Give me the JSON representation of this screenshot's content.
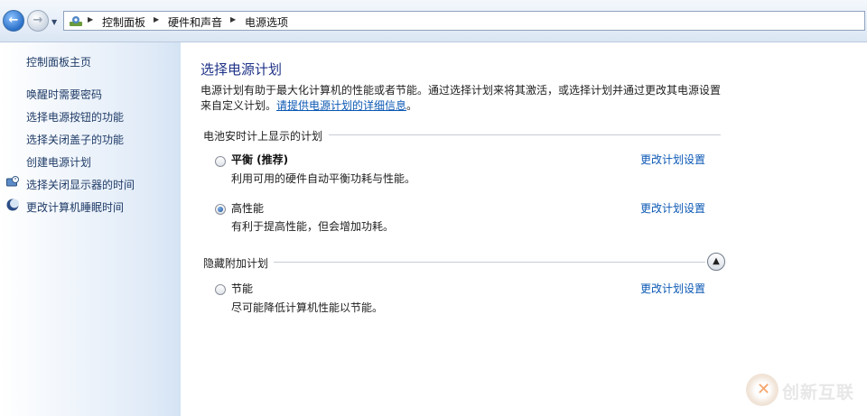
{
  "breadcrumb": [
    "控制面板",
    "硬件和声音",
    "电源选项"
  ],
  "sidebar": {
    "home": "控制面板主页",
    "links": [
      "唤醒时需要密码",
      "选择电源按钮的功能",
      "选择关闭盖子的功能",
      "创建电源计划"
    ],
    "icon_links": [
      "选择关闭显示器的时间",
      "更改计算机睡眠时间"
    ]
  },
  "main": {
    "title": "选择电源计划",
    "description": "电源计划有助于最大化计算机的性能或者节能。通过选择计划来将其激活，或选择计划并通过更改其电源设置来自定义计划。",
    "details_link": "请提供电源计划的详细信息",
    "details_end": "。",
    "battery_group": "电池安时计上显示的计划",
    "hidden_group": "隐藏附加计划",
    "plans": [
      {
        "name": "平衡 (推荐)",
        "desc": "利用可用的硬件自动平衡功耗与性能。",
        "change": "更改计划设置",
        "selected": false
      },
      {
        "name": "高性能",
        "desc": "有利于提高性能，但会增加功耗。",
        "change": "更改计划设置",
        "selected": true
      },
      {
        "name": "节能",
        "desc": "尽可能降低计算机性能以节能。",
        "change": "更改计划设置",
        "selected": false
      }
    ]
  },
  "watermark": "创新互联",
  "colors": {
    "title": "#1e3287",
    "link": "#0b58b4",
    "sidebar_link": "#1f3b67"
  }
}
